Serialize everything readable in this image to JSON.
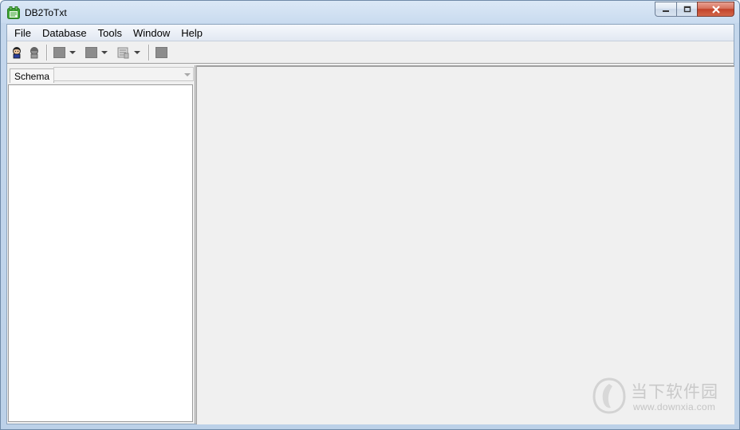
{
  "window": {
    "title": "DB2ToTxt"
  },
  "menubar": {
    "items": [
      "File",
      "Database",
      "Tools",
      "Window",
      "Help"
    ]
  },
  "toolbar": {
    "buttons": [
      "connect-icon",
      "disconnect-icon",
      "export-icon",
      "import-icon",
      "report-icon",
      "stop-icon"
    ]
  },
  "left_panel": {
    "schema_label": "Schema",
    "schema_value": ""
  },
  "watermark": {
    "text": "当下软件园",
    "url": "www.downxia.com"
  },
  "colors": {
    "titlebar": "#c9dbef",
    "close_button": "#c2432a",
    "client_bg": "#f0f0f0",
    "tree_bg": "#ffffff"
  }
}
